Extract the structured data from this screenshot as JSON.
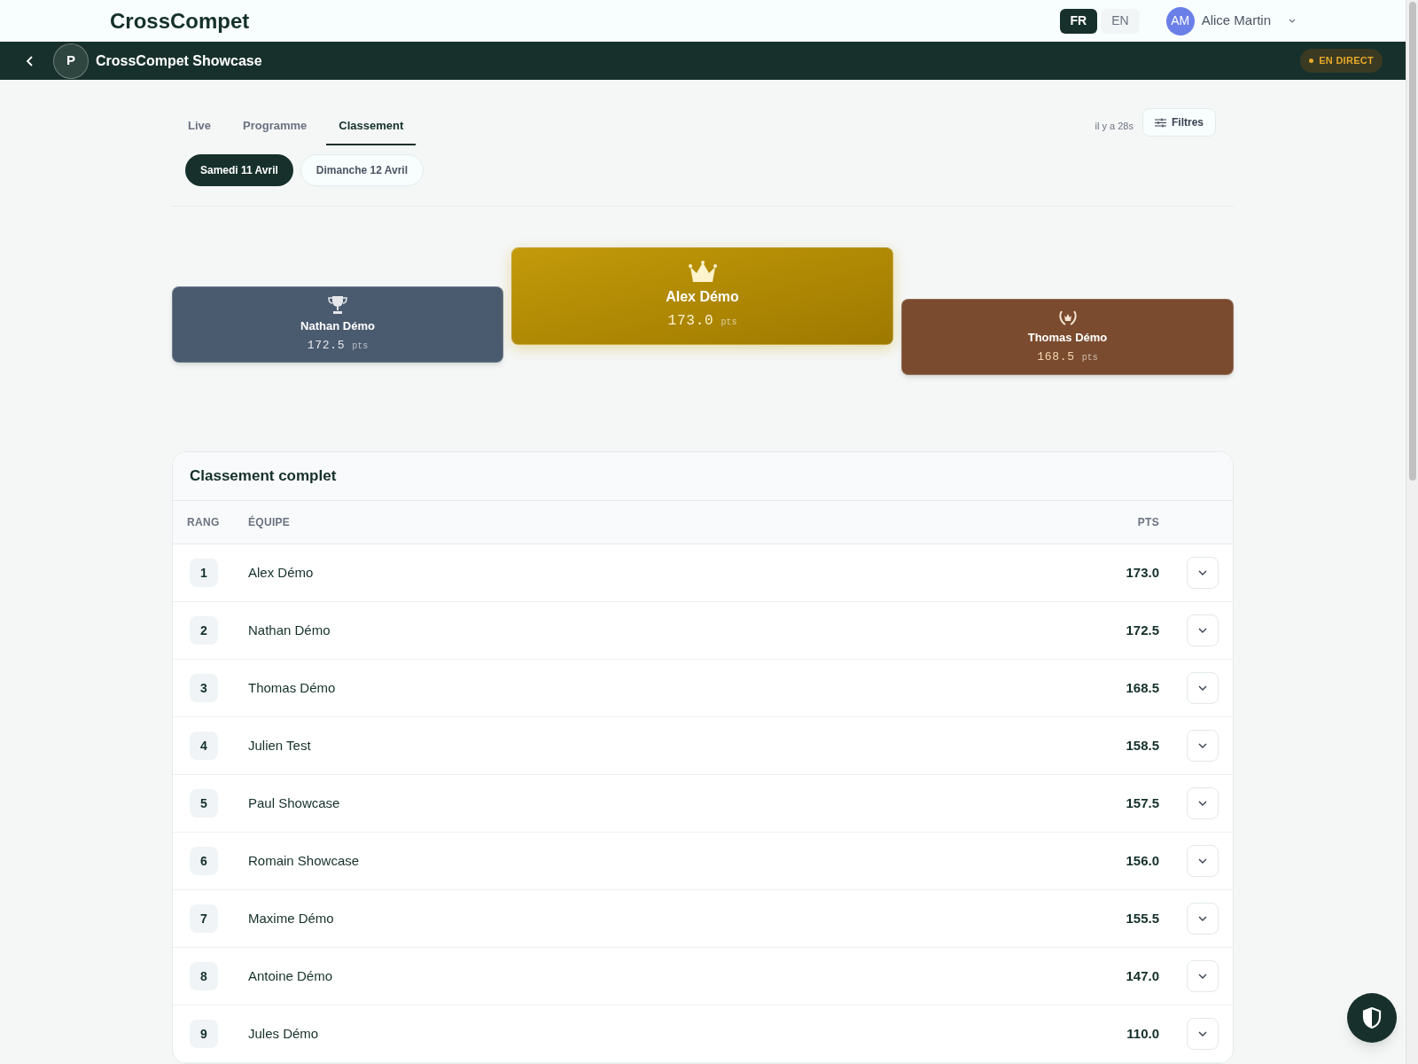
{
  "app": {
    "logo": "CrossCompet"
  },
  "languages": [
    {
      "label": "FR",
      "selected": true
    },
    {
      "label": "EN",
      "selected": false
    }
  ],
  "user": {
    "initials": "AM",
    "name": "Alice Martin"
  },
  "event_bar": {
    "avatar": "P",
    "title": "CrossCompet Showcase",
    "live_badge": "EN DIRECT"
  },
  "tabs": [
    {
      "label": "Live",
      "selected": false
    },
    {
      "label": "Programme",
      "selected": false
    },
    {
      "label": "Classement",
      "selected": true
    }
  ],
  "updated": "il y a 28s",
  "filter_button": "Filtres",
  "days": [
    {
      "label": "Samedi 11 Avril",
      "selected": true
    },
    {
      "label": "Dimanche 12 Avril",
      "selected": false
    }
  ],
  "podium": [
    {
      "kind": "trophy",
      "name": "Nathan Démo",
      "points": "172.5",
      "unit": "pts"
    },
    {
      "kind": "crown",
      "name": "Alex Démo",
      "points": "173.0",
      "unit": "pts"
    },
    {
      "kind": "laurel",
      "name": "Thomas Démo",
      "points": "168.5",
      "unit": "pts"
    }
  ],
  "table": {
    "title": "Classement complet",
    "columns": [
      "RANG",
      "ÉQUIPE",
      "PTS"
    ],
    "rows": [
      {
        "rank": "1",
        "team": "Alex Démo",
        "points": "173.0"
      },
      {
        "rank": "2",
        "team": "Nathan Démo",
        "points": "172.5"
      },
      {
        "rank": "3",
        "team": "Thomas Démo",
        "points": "168.5"
      },
      {
        "rank": "4",
        "team": "Julien Test",
        "points": "158.5"
      },
      {
        "rank": "5",
        "team": "Paul Showcase",
        "points": "157.5"
      },
      {
        "rank": "6",
        "team": "Romain Showcase",
        "points": "156.0"
      },
      {
        "rank": "7",
        "team": "Maxime Démo",
        "points": "155.5"
      },
      {
        "rank": "8",
        "team": "Antoine Démo",
        "points": "147.0"
      },
      {
        "rank": "9",
        "team": "Jules Démo",
        "points": "110.0"
      }
    ]
  }
}
